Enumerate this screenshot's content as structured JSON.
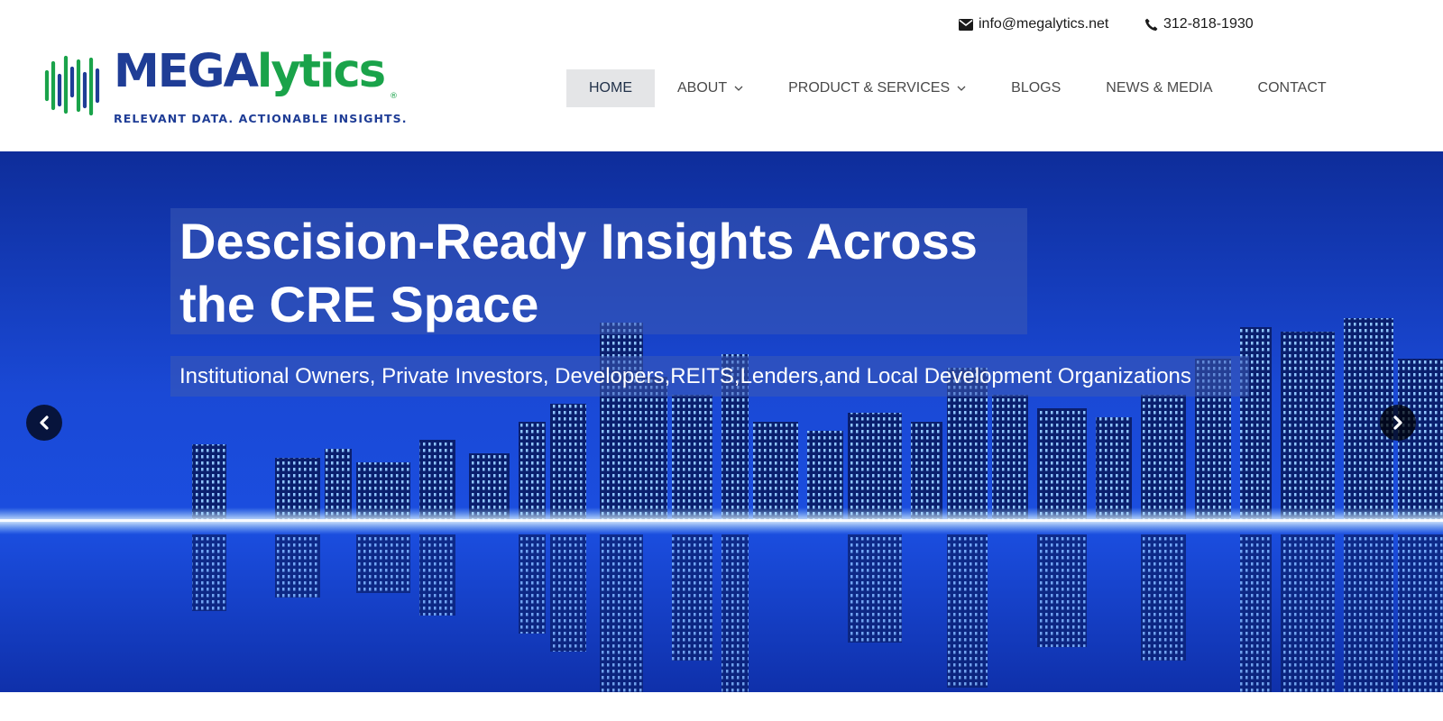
{
  "contact": {
    "email": "info@megalytics.net",
    "phone": "312-818-1930"
  },
  "logo": {
    "word_mega": "MEGA",
    "word_lytics": "lytics",
    "registered": "®",
    "tagline": "RELEVANT DATA. ACTIONABLE INSIGHTS."
  },
  "nav": {
    "items": [
      {
        "label": "HOME",
        "active": true,
        "dropdown": false
      },
      {
        "label": "ABOUT",
        "active": false,
        "dropdown": true
      },
      {
        "label": "PRODUCT & SERVICES",
        "active": false,
        "dropdown": true
      },
      {
        "label": "BLOGS",
        "active": false,
        "dropdown": false
      },
      {
        "label": "NEWS & MEDIA",
        "active": false,
        "dropdown": false
      },
      {
        "label": "CONTACT",
        "active": false,
        "dropdown": false
      }
    ]
  },
  "hero": {
    "headline": "Descision-Ready Insights Across the CRE Space",
    "subtitle": "Institutional Owners, Private Investors, Developers,REITS,Lenders,and Local Development Organizations"
  },
  "colors": {
    "brand_blue": "#1f3d96",
    "brand_green": "#1aa34a",
    "nav_active_bg": "#e4e5e7"
  },
  "icons": [
    "envelope-icon",
    "phone-icon",
    "chevron-down-icon",
    "chevron-left-icon",
    "chevron-right-icon"
  ]
}
